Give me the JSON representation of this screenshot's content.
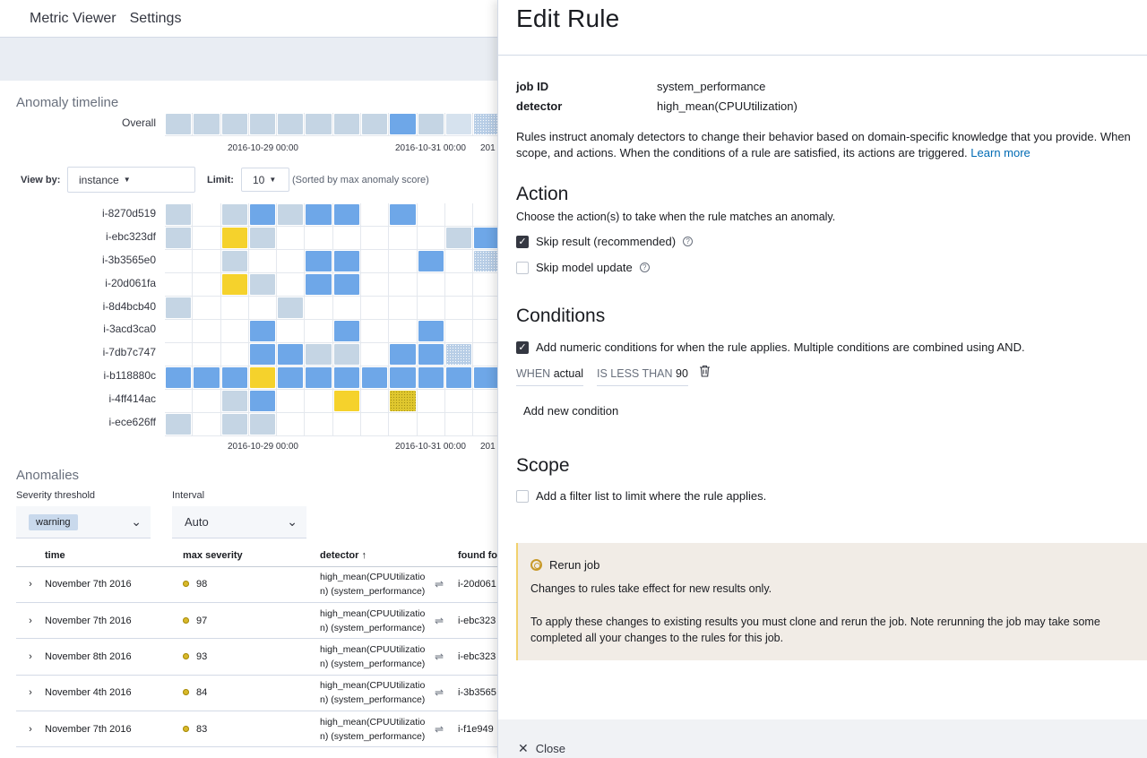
{
  "nav": {
    "items": [
      "Metric Viewer",
      "Settings"
    ]
  },
  "timeline": {
    "title": "Anomaly timeline",
    "overall_label": "Overall",
    "overall_cells": [
      1,
      1,
      1,
      1,
      1,
      1,
      1,
      1,
      2,
      1,
      4,
      6
    ],
    "ticks": [
      "2016-10-29 00:00",
      "2016-10-31 00:00",
      "201"
    ],
    "view_by_label": "View by:",
    "view_by_value": "instance",
    "limit_label": "Limit:",
    "limit_value": "10",
    "limit_hint": "(Sorted by max anomaly score)",
    "rows": [
      {
        "label": "i-8270d519",
        "cells": [
          1,
          0,
          1,
          2,
          1,
          2,
          2,
          0,
          2,
          0,
          0,
          0
        ]
      },
      {
        "label": "i-ebc323df",
        "cells": [
          1,
          0,
          3,
          1,
          0,
          0,
          0,
          0,
          0,
          0,
          1,
          2
        ]
      },
      {
        "label": "i-3b3565e0",
        "cells": [
          0,
          0,
          1,
          0,
          0,
          2,
          2,
          0,
          0,
          2,
          0,
          6
        ]
      },
      {
        "label": "i-20d061fa",
        "cells": [
          0,
          0,
          3,
          1,
          0,
          2,
          2,
          0,
          0,
          0,
          0,
          0
        ]
      },
      {
        "label": "i-8d4bcb40",
        "cells": [
          1,
          0,
          0,
          0,
          1,
          0,
          0,
          0,
          0,
          0,
          0,
          0
        ]
      },
      {
        "label": "i-3acd3ca0",
        "cells": [
          0,
          0,
          0,
          2,
          0,
          0,
          2,
          0,
          0,
          2,
          0,
          0
        ]
      },
      {
        "label": "i-7db7c747",
        "cells": [
          0,
          0,
          0,
          2,
          2,
          1,
          1,
          0,
          2,
          2,
          6,
          0
        ]
      },
      {
        "label": "i-b118880c",
        "cells": [
          2,
          2,
          2,
          3,
          2,
          2,
          2,
          2,
          2,
          2,
          2,
          2
        ]
      },
      {
        "label": "i-4ff414ac",
        "cells": [
          0,
          0,
          1,
          2,
          0,
          0,
          3,
          0,
          5,
          0,
          0,
          0
        ]
      },
      {
        "label": "i-ece626ff",
        "cells": [
          1,
          0,
          1,
          1,
          0,
          0,
          0,
          0,
          0,
          0,
          0,
          0
        ]
      }
    ]
  },
  "anomalies": {
    "title": "Anomalies",
    "severity_label": "Severity threshold",
    "severity_value": "warning",
    "interval_label": "Interval",
    "interval_value": "Auto",
    "columns": [
      "time",
      "max severity",
      "detector",
      "found fo"
    ],
    "rows": [
      {
        "time": "November 7th 2016",
        "severity": "98",
        "detector": "high_mean(CPUUtilizatio n) (system_performance)",
        "found": "i-20d061"
      },
      {
        "time": "November 7th 2016",
        "severity": "97",
        "detector": "high_mean(CPUUtilizatio n) (system_performance)",
        "found": "i-ebc323"
      },
      {
        "time": "November 8th 2016",
        "severity": "93",
        "detector": "high_mean(CPUUtilizatio n) (system_performance)",
        "found": "i-ebc323"
      },
      {
        "time": "November 4th 2016",
        "severity": "84",
        "detector": "high_mean(CPUUtilizatio n) (system_performance)",
        "found": "i-3b3565"
      },
      {
        "time": "November 7th 2016",
        "severity": "83",
        "detector": "high_mean(CPUUtilizatio n) (system_performance)",
        "found": "i-f1e949"
      }
    ]
  },
  "flyout": {
    "title": "Edit Rule",
    "job_id_label": "job ID",
    "job_id_value": "system_performance",
    "detector_label": "detector",
    "detector_value": "high_mean(CPUUtilization)",
    "description_line1": "Rules instruct anomaly detectors to change their behavior based on domain-specific knowledge that you provide. When",
    "description_line2": "scope, and actions. When the conditions of a rule are satisfied, its actions are triggered.",
    "learn_more": "Learn more",
    "action_title": "Action",
    "action_sub": "Choose the action(s) to take when the rule matches an anomaly.",
    "skip_result": "Skip result (recommended)",
    "skip_result_checked": true,
    "skip_model": "Skip model update",
    "skip_model_checked": false,
    "conditions_title": "Conditions",
    "conditions_checkbox": "Add numeric conditions for when the rule applies. Multiple conditions are combined using AND.",
    "conditions_checked": true,
    "condition": {
      "when_kw": "WHEN",
      "when_value": "actual",
      "op_kw": "IS LESS THAN",
      "op_value": "90"
    },
    "add_condition": "Add new condition",
    "scope_title": "Scope",
    "scope_checkbox": "Add a filter list to limit where the rule applies.",
    "scope_checked": false,
    "callout": {
      "title": "Rerun job",
      "line1": "Changes to rules take effect for new results only.",
      "line2": "To apply these changes to existing results you must clone and rerun the job. Note rerunning the job may take some",
      "line3": "completed all your changes to the rules for this job."
    },
    "close_label": "Close"
  }
}
